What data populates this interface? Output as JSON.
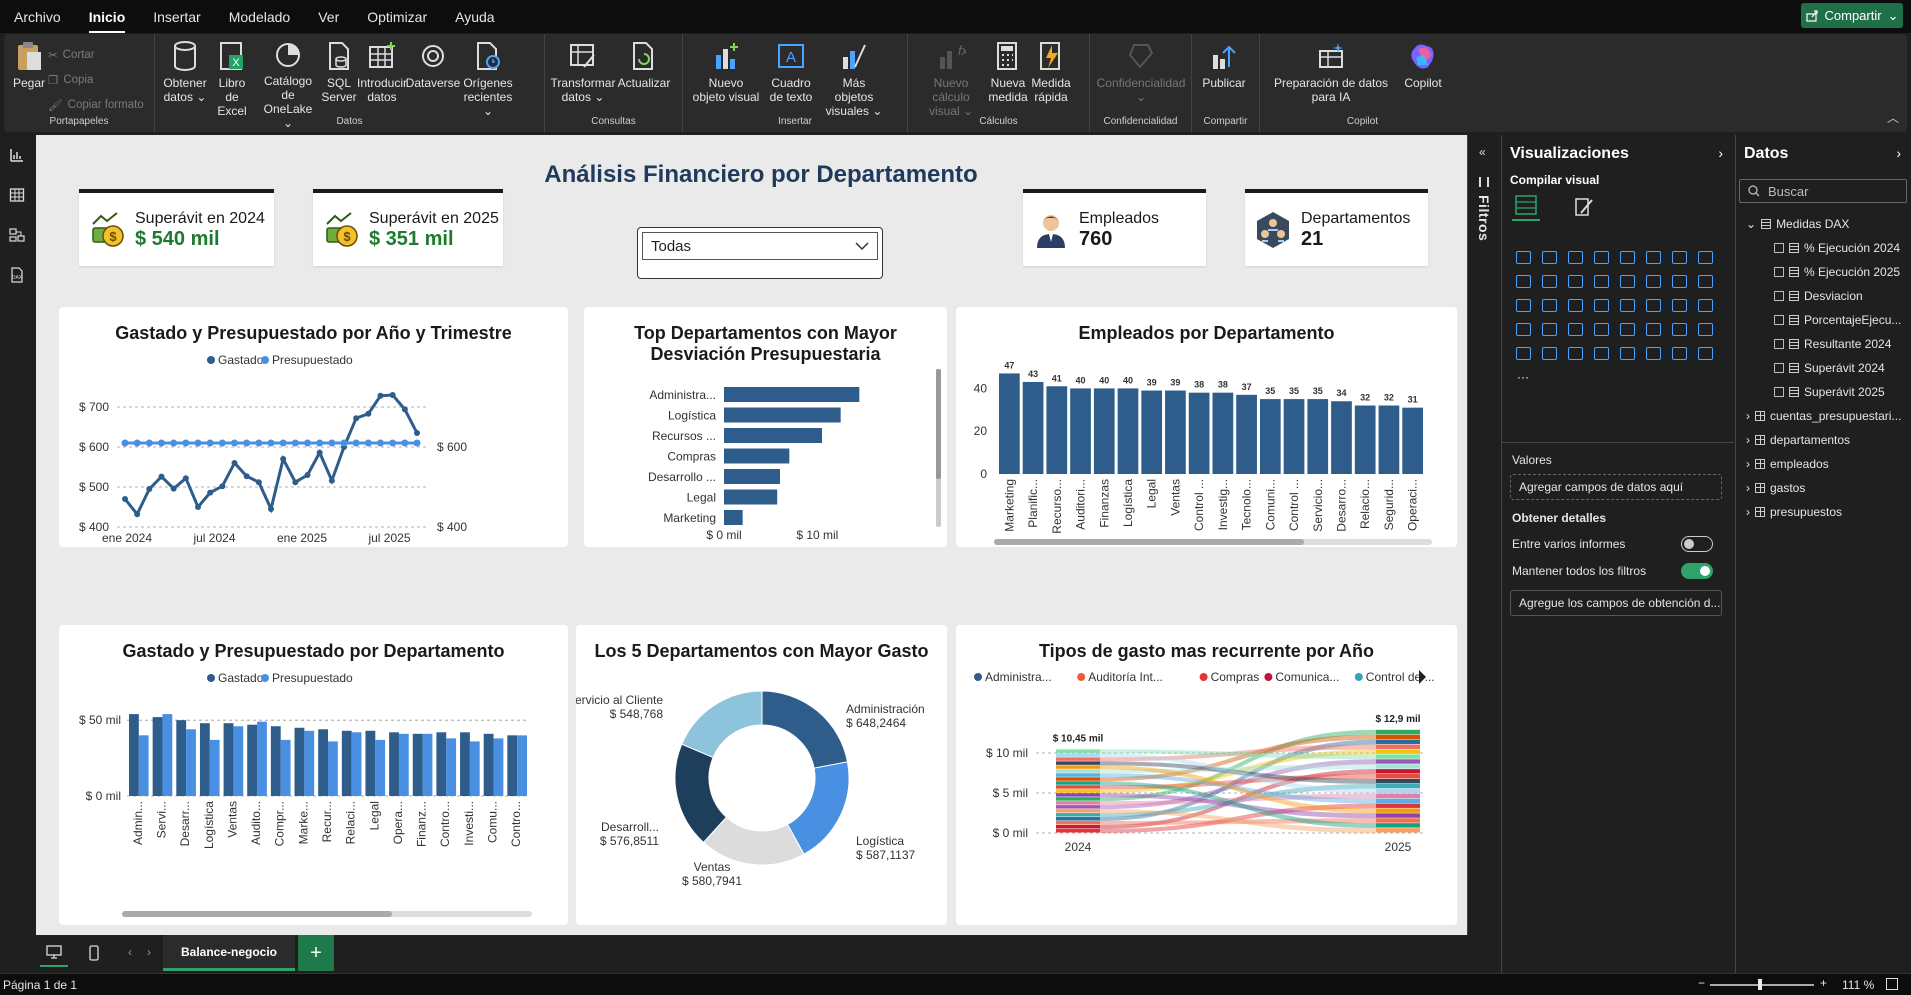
{
  "menu": [
    "Archivo",
    "Inicio",
    "Insertar",
    "Modelado",
    "Ver",
    "Optimizar",
    "Ayuda"
  ],
  "share_label": "Compartir",
  "ribbon": {
    "clipboard": {
      "paste": "Pegar",
      "cut": "Cortar",
      "copy": "Copia",
      "format": "Copiar formato",
      "label": "Portapapeles"
    },
    "data": {
      "label": "Datos",
      "items": [
        "Obtener datos ⌄",
        "Libro de Excel",
        "Catálogo de OneLake ⌄",
        "SQL Server",
        "Introducir datos",
        "Dataverse",
        "Orígenes recientes ⌄"
      ]
    },
    "queries": {
      "label": "Consultas",
      "items": [
        "Transformar datos ⌄",
        "Actualizar"
      ]
    },
    "insert": {
      "label": "Insertar",
      "items": [
        "Nuevo objeto visual",
        "Cuadro de texto",
        "Más objetos visuales ⌄"
      ]
    },
    "calcs": {
      "label": "Cálculos",
      "items": [
        "Nuevo cálculo visual ⌄",
        "Nueva medida",
        "Medida rápida"
      ]
    },
    "sensitivity": {
      "label": "Confidencialidad",
      "items": [
        "Confidencialidad ⌄"
      ]
    },
    "share": {
      "label": "Compartir",
      "items": [
        "Publicar"
      ]
    },
    "copilot": {
      "label": "Copilot",
      "items": [
        "Preparación de datos para IA",
        "Copilot"
      ]
    }
  },
  "report": {
    "title": "Análisis Financiero por Departamento",
    "cards": {
      "c1": {
        "label": "Superávit en 2024",
        "value": "$ 540 mil"
      },
      "c2": {
        "label": "Superávit en 2025",
        "value": "$ 351 mil"
      },
      "c3": {
        "label": "Empleados",
        "value": "760"
      },
      "c4": {
        "label": "Departamentos",
        "value": "21"
      }
    },
    "slicer_value": "Todas"
  },
  "chart_data": [
    {
      "type": "line",
      "title": "Gastado y Presupuestado por Año y Trimestre",
      "series": [
        {
          "name": "Gastado",
          "values": [
            470,
            432,
            495,
            526,
            496,
            522,
            450,
            486,
            502,
            560,
            527,
            512,
            445,
            570,
            512,
            530,
            586,
            516,
            600,
            672,
            683,
            728,
            730,
            694,
            635
          ]
        },
        {
          "name": "Presupuestado",
          "values": [
            610,
            610,
            610,
            610,
            610,
            610,
            610,
            610,
            610,
            610,
            610,
            610,
            610,
            610,
            610,
            610,
            610,
            610,
            610,
            610,
            610,
            610,
            610,
            610,
            610
          ]
        }
      ],
      "x_labels": [
        "ene 2024",
        "jul 2024",
        "ene 2025",
        "jul 2025"
      ],
      "y_ticks": [
        "$ 400",
        "$ 500",
        "$ 600",
        "$ 700"
      ],
      "y2_ticks": [
        "$ 400",
        "$ 600"
      ],
      "ylim": [
        400,
        750
      ],
      "y2lim": [
        400,
        750
      ],
      "y2_series": "Presupuestado",
      "grid": true,
      "legend": "top"
    },
    {
      "type": "bar",
      "orientation": "horizontal",
      "title": "Top Departamentos con Mayor Desviación Presupuestaria",
      "categories": [
        "Administra...",
        "Logística",
        "Recursos ...",
        "Compras",
        "Desarrollo ...",
        "Legal",
        "Marketing"
      ],
      "values": [
        14.5,
        12.5,
        10.5,
        7,
        6,
        5.7,
        2
      ],
      "x_ticks": [
        "$ 0 mil",
        "$ 10 mil"
      ],
      "xlim": [
        0,
        18
      ],
      "color": "#2e5d8c"
    },
    {
      "type": "bar",
      "title": "Empleados por Departamento",
      "categories": [
        "Marketing",
        "Planific...",
        "Recurso...",
        "Auditori...",
        "Finanzas",
        "Logística",
        "Legal",
        "Ventas",
        "Control ...",
        "Investig...",
        "Tecnolo...",
        "Comuni...",
        "Control ...",
        "Servicio...",
        "Desarro...",
        "Relacio...",
        "Segurid...",
        "Operaci..."
      ],
      "values": [
        47,
        43,
        41,
        40,
        40,
        40,
        39,
        39,
        38,
        38,
        37,
        35,
        35,
        35,
        34,
        32,
        32,
        31
      ],
      "y_ticks": [
        "0",
        "20",
        "40"
      ],
      "ylim": [
        0,
        50
      ],
      "color": "#2e5d8c"
    },
    {
      "type": "bar",
      "title": "Gastado y Presupuestado por Departamento",
      "categories": [
        "Admin...",
        "Servi...",
        "Desarr...",
        "Logística",
        "Ventas",
        "Audito...",
        "Compr...",
        "Marke...",
        "Recur...",
        "Relaci...",
        "Legal",
        "Opera...",
        "Finanz...",
        "Contro...",
        "Investi...",
        "Comu...",
        "Contro..."
      ],
      "series": [
        {
          "name": "Gastado",
          "values": [
            54,
            52,
            50,
            48,
            48,
            47,
            46,
            45,
            44,
            43,
            43,
            42,
            41,
            42,
            42,
            41,
            40
          ]
        },
        {
          "name": "Presupuestado",
          "values": [
            40,
            54,
            44,
            37,
            46,
            49,
            37,
            43,
            36,
            42,
            37,
            41,
            41,
            38,
            36,
            38,
            40
          ]
        }
      ],
      "y_ticks": [
        "$ 0 mil",
        "$ 50 mil"
      ],
      "ylim": [
        0,
        60
      ],
      "legend": "top"
    },
    {
      "type": "pie",
      "title": "Los 5 Departamentos con Mayor Gasto",
      "labels": [
        "Administración",
        "Logística",
        "Ventas",
        "Desarroll...",
        "Servicio al Cliente"
      ],
      "values": [
        648.2464,
        587.1137,
        580.7941,
        576.8511,
        548.768
      ],
      "value_labels": [
        "$ 648,2464",
        "$ 587,1137",
        "$ 580,7941",
        "$ 576,8511",
        "$ 548,768"
      ],
      "colors": [
        "#2e5d8c",
        "#4a90e2",
        "#dcdcdc",
        "#1e3f5c",
        "#8ec3dc"
      ],
      "donut": true
    },
    {
      "type": "area",
      "subtype": "ribbon",
      "title": "Tipos de gasto mas recurrente por Año",
      "legend_items": [
        "Administra...",
        "Auditoría Int...",
        "Compras",
        "Comunica...",
        "Control de ..."
      ],
      "legend_colors": [
        "#2e5d8c",
        "#f05a3c",
        "#e3342f",
        "#c0143c",
        "#3aa0b8"
      ],
      "categories": [
        "2024",
        "2025"
      ],
      "totals": [
        10.45,
        12.9
      ],
      "total_labels": [
        "$ 10,45 mil",
        "$ 12,9 mil"
      ],
      "y_ticks": [
        "$ 0 mil",
        "$ 5 mil",
        "$ 10 mil"
      ],
      "ylim": [
        0,
        13.5
      ],
      "band_colors": [
        "#e0343a",
        "#c9152f",
        "#f07050",
        "#2f6b9a",
        "#3fa9b5",
        "#f4a261",
        "#9b59b6",
        "#e67ea6",
        "#27ae60",
        "#8e44ad",
        "#f1c40f",
        "#e74c3c",
        "#16a085",
        "#d35400",
        "#5dade2",
        "#a3e4d7",
        "#f39c12",
        "#34495e",
        "#ec7063",
        "#aed6f1",
        "#82e0aa"
      ]
    }
  ],
  "viz_pane": {
    "title": "Visualizaciones",
    "build": "Compilar visual",
    "values_label": "Valores",
    "values_drop": "Agregar campos de datos aquí",
    "details_label": "Obtener detalles",
    "cross_report": "Entre varios informes",
    "keep_filters": "Mantener todos los filtros",
    "details_drop": "Agregue los campos de obtención d..."
  },
  "data_pane": {
    "title": "Datos",
    "search_placeholder": "Buscar",
    "measures_table": "Medidas DAX",
    "measures": [
      "% Ejecución 2024",
      "% Ejecución 2025",
      "Desviacion",
      "PorcentajeEjecu...",
      "Resultante 2024",
      "Superávit 2024",
      "Superávit 2025"
    ],
    "tables": [
      "cuentas_presupuestari...",
      "departamentos",
      "empleados",
      "gastos",
      "presupuestos"
    ]
  },
  "filters_label": "Filtros",
  "page_tab": "Balance-negocio",
  "status": {
    "page": "Página 1 de 1",
    "zoom": "111 %"
  }
}
